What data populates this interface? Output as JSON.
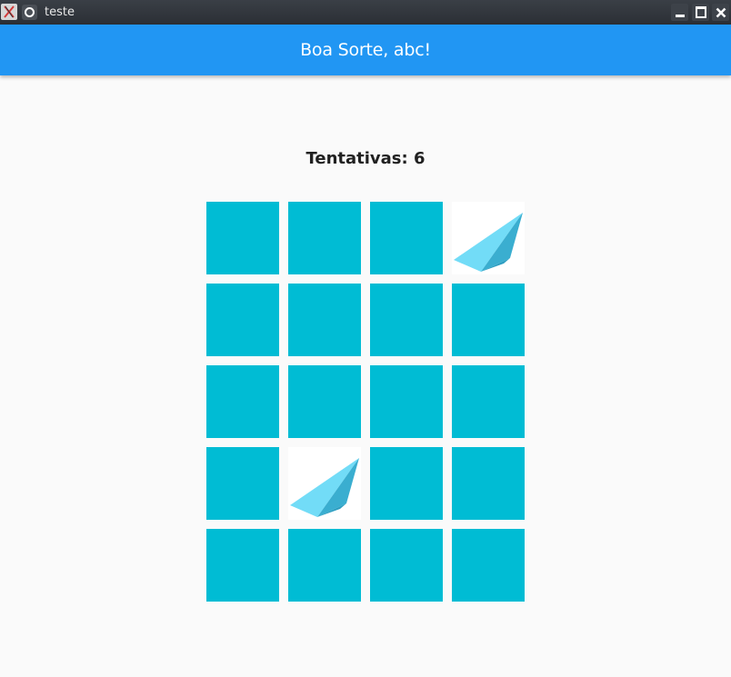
{
  "window": {
    "title": "teste",
    "app_icon": "x-app-icon",
    "pin_icon": "pin-icon",
    "controls": [
      "minimize-icon",
      "maximize-icon",
      "close-icon"
    ]
  },
  "appbar": {
    "title": "Boa Sorte, abc!",
    "color": "#2196f3"
  },
  "game": {
    "attempts_label": "Tentativas: 6",
    "card_back_color": "#00bcd4",
    "face_image": "paper-plane-icon",
    "rows": 5,
    "cols": 4,
    "cards": [
      {
        "revealed": false
      },
      {
        "revealed": false
      },
      {
        "revealed": false
      },
      {
        "revealed": true
      },
      {
        "revealed": false
      },
      {
        "revealed": false
      },
      {
        "revealed": false
      },
      {
        "revealed": false
      },
      {
        "revealed": false
      },
      {
        "revealed": false
      },
      {
        "revealed": false
      },
      {
        "revealed": false
      },
      {
        "revealed": false
      },
      {
        "revealed": true
      },
      {
        "revealed": false
      },
      {
        "revealed": false
      },
      {
        "revealed": false
      },
      {
        "revealed": false
      },
      {
        "revealed": false
      },
      {
        "revealed": false
      }
    ]
  }
}
